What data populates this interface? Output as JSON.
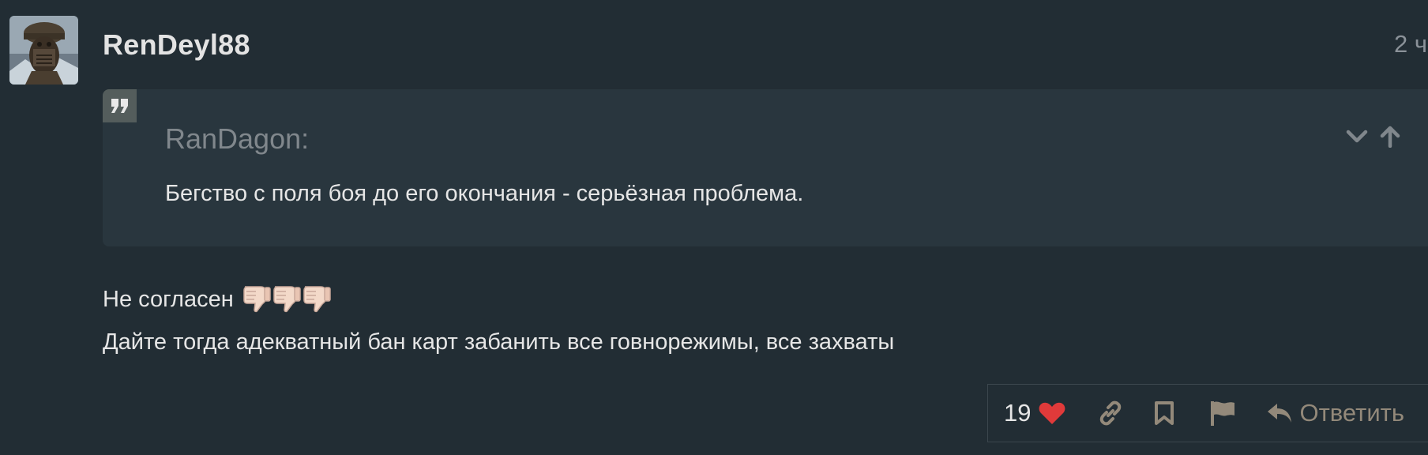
{
  "post": {
    "username": "RenDeyl88",
    "date": "2 ч"
  },
  "quote": {
    "author": "RanDagon:",
    "text": "Бегство с поля боя до его окончания - серьёзная проблема."
  },
  "body": {
    "line1": "Не согласен",
    "emoji": "thumbs-down",
    "emoji_count": 3,
    "line2": "Дайте тогда адекватный бан карт забанить все говнорежимы, все захваты"
  },
  "actions": {
    "like_count": "19",
    "reply_label": "Ответить"
  },
  "colors": {
    "background": "#222d34",
    "quote_background": "#29363e",
    "heart": "#e03a3a",
    "action_icon": "#93897a",
    "muted_text": "#80878c"
  },
  "icons": {
    "quote": "quote-icon",
    "expand": "chevron-down-icon",
    "jump": "arrow-up-icon",
    "like": "heart-icon",
    "link": "link-icon",
    "bookmark": "bookmark-icon",
    "flag": "flag-icon",
    "reply": "reply-icon"
  }
}
